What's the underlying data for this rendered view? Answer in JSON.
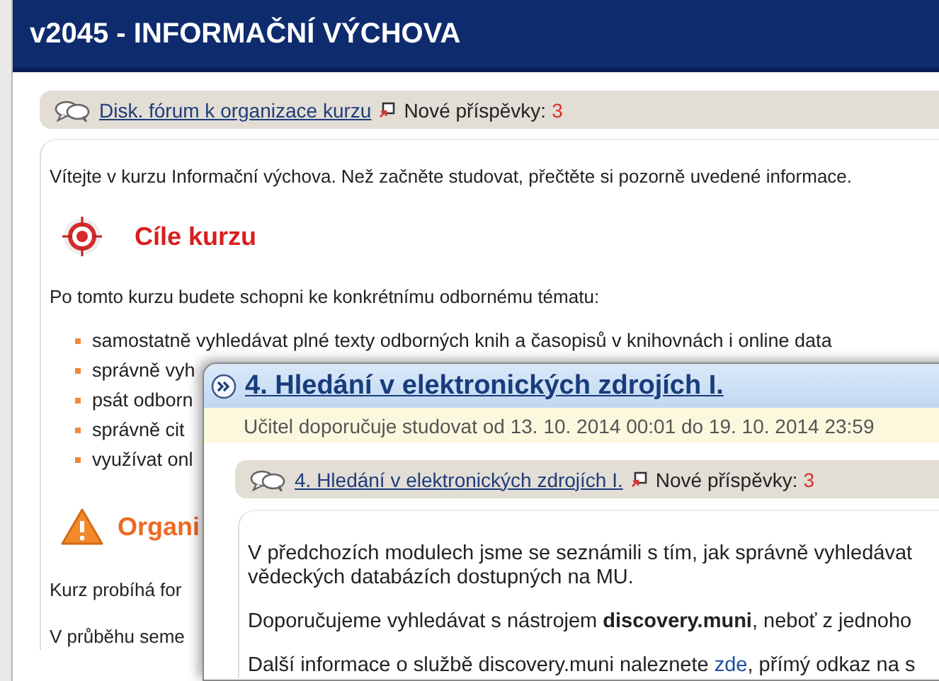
{
  "header": {
    "title": "v2045 - INFORMAČNÍ VÝCHOVA"
  },
  "forum": {
    "link": "Disk. fórum k organizace kurzu",
    "new_label": "Nové příspěvky:",
    "new_count": "3"
  },
  "intro": "Vítejte v kurzu Informační výchova. Než začněte studovat, přečtěte si pozorně uvedené informace.",
  "sections": [
    {
      "kind": "goals",
      "heading": "Cíle kurzu",
      "paragraphs": [
        "Po tomto kurzu budete schopni ke konkrétnímu odbornému tématu:"
      ],
      "bullets": [
        "samostatně vyhledávat plné texty odborných knih a časopisů v knihovnách i online data",
        "správně vyh",
        "psát odborn",
        "správně cit",
        "využívat onl"
      ]
    },
    {
      "kind": "warning",
      "heading": "Organi",
      "paragraphs": [
        "Kurz probíhá for",
        "V průběhu seme"
      ]
    }
  ],
  "module": {
    "title": "4. Hledání v elektronických zdrojích I.",
    "schedule": "Učitel doporučuje studovat od 13. 10. 2014 00:01 do 19. 10. 2014 23:59",
    "forum": {
      "link": "4. Hledání v elektronických zdrojích I.",
      "new_label": "Nové příspěvky:",
      "new_count": "3"
    },
    "paragraphs": [
      {
        "lines": [
          "V předchozích modulech jsme se seznámili s tím, jak správně vyhledávat",
          "vědeckých databázích dostupných na MU."
        ]
      },
      {
        "lines": [
          "Doporučujeme vyhledávat s nástrojem **discovery.muni**, neboť z jednoho"
        ]
      },
      {
        "before": "Další informace o službě discovery.muni naleznete ",
        "link": "zde",
        "after": ", přímý odkaz na s"
      }
    ]
  }
}
